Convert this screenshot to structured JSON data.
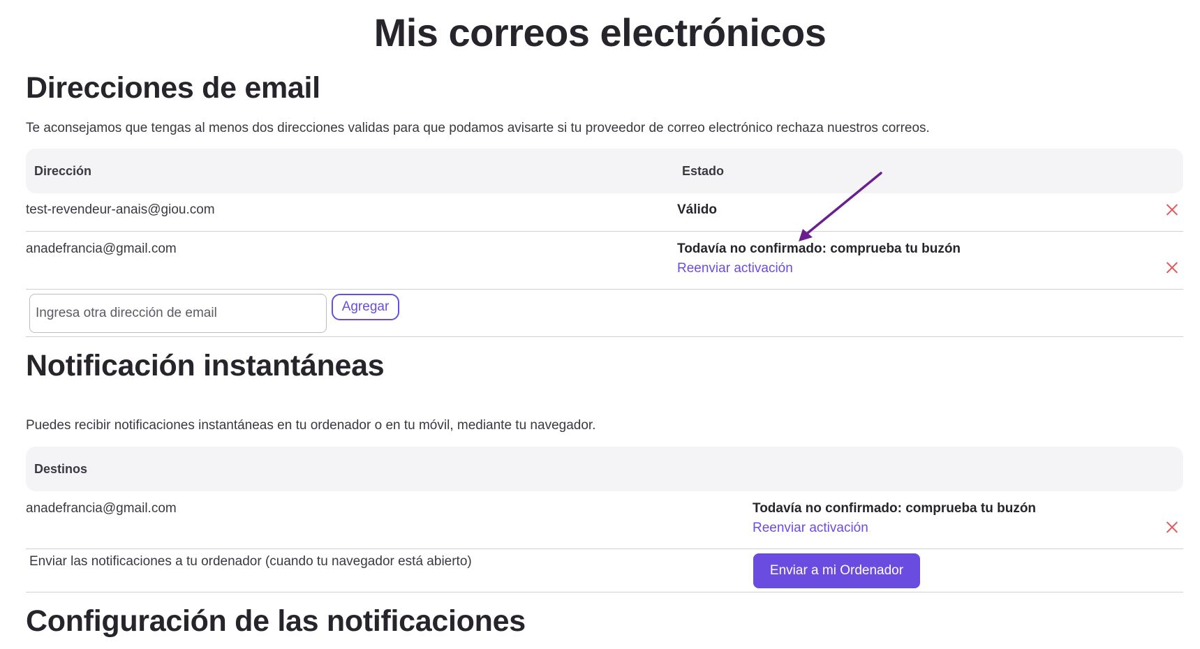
{
  "page_title": "Mis correos electrónicos",
  "emails_section": {
    "heading": "Direcciones de email",
    "intro": "Te aconsejamos que tengas al menos dos direcciones validas para que podamos avisarte si tu proveedor de correo electrónico rechaza nuestros correos.",
    "columns": {
      "address": "Dirección",
      "status": "Estado"
    },
    "rows": [
      {
        "address": "test-revendeur-anais@giou.com",
        "status": "Válido",
        "action": ""
      },
      {
        "address": "anadefrancia@gmail.com",
        "status": "Todavía no confirmado: comprueba tu buzón",
        "action": "Reenviar activación"
      }
    ],
    "input_placeholder": "Ingresa otra dirección de email",
    "add_label": "Agregar"
  },
  "push_section": {
    "heading": "Notificación instantáneas",
    "intro": "Puedes recibir notificaciones instantáneas en tu ordenador o en tu móvil, mediante tu navegador.",
    "column": "Destinos",
    "row": {
      "destination": "anadefrancia@gmail.com",
      "status": "Todavía no confirmado: comprueba tu buzón",
      "action": "Reenviar activación"
    },
    "computer_text": "Enviar las notificaciones a tu ordenador (cuando tu navegador está abierto)",
    "computer_button": "Enviar a mi Ordenador"
  },
  "config_section": {
    "heading": "Configuración de las notificaciones"
  },
  "colors": {
    "accent": "#6b4ce0",
    "delete": "#e05a5a",
    "header_bg": "#f4f4f6",
    "annotation_arrow": "#6a1f8f"
  },
  "icons": {
    "delete": "close-icon",
    "annotation": "arrow-annotation"
  }
}
